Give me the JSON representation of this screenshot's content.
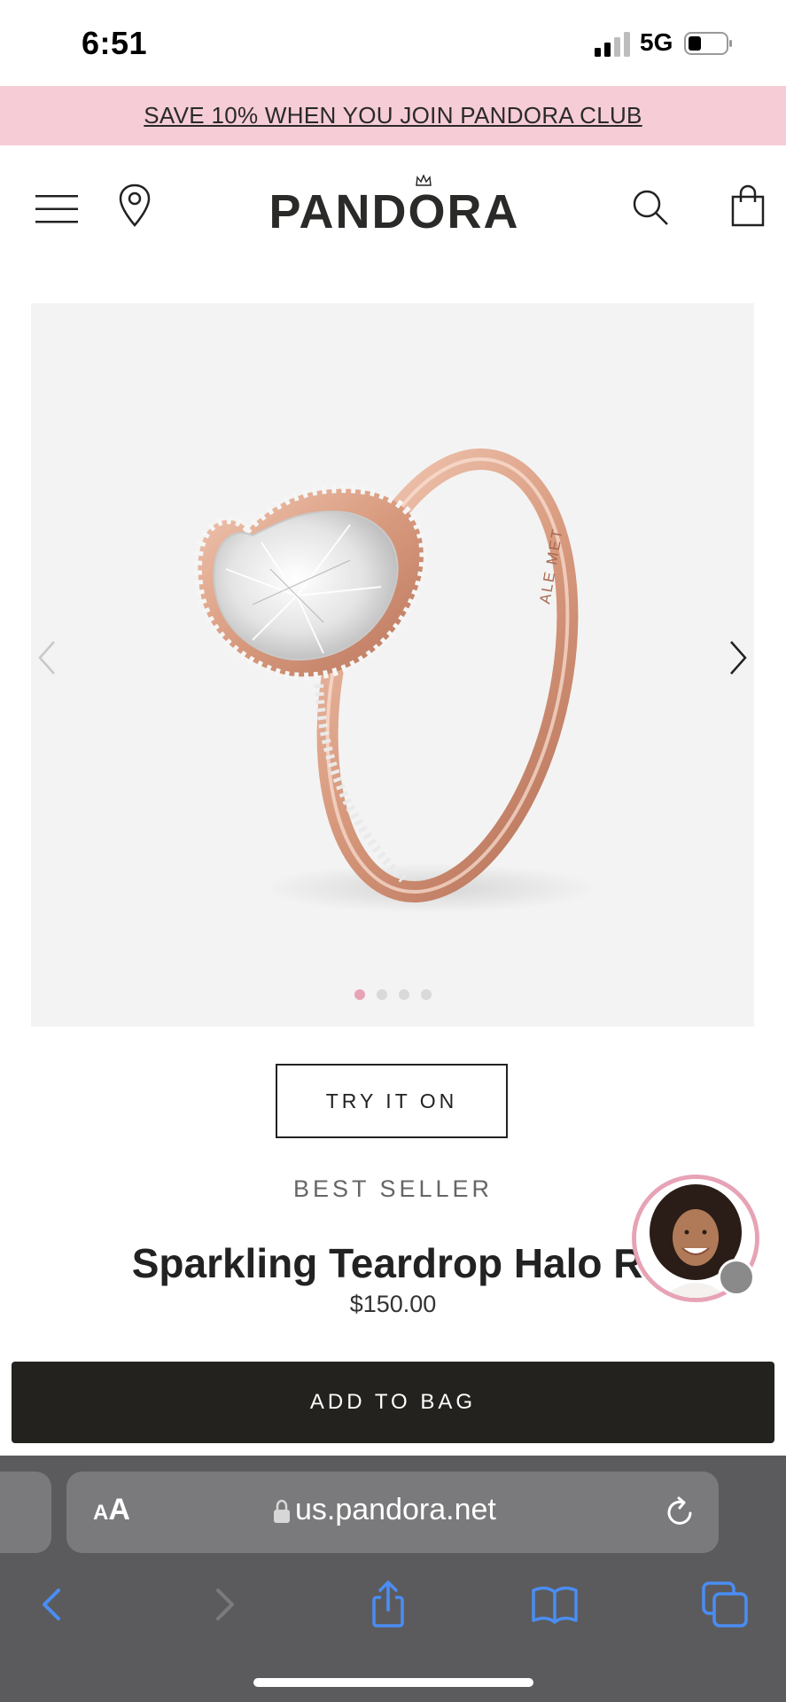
{
  "status_bar": {
    "time": "6:51",
    "network": "5G"
  },
  "promo": {
    "text": "SAVE 10% WHEN YOU JOIN PANDORA CLUB"
  },
  "header": {
    "brand": "PANDORA"
  },
  "carousel": {
    "image_count": 4,
    "active_index": 0,
    "active_dot_color": "#e7a3b5",
    "ring_engraving": "ALE MET"
  },
  "product": {
    "try_on_label": "TRY IT ON",
    "badge": "BEST SELLER",
    "title": "Sparkling Teardrop Halo Ri",
    "price": "$150.00",
    "add_to_bag_label": "ADD TO BAG"
  },
  "browser": {
    "aa_small": "A",
    "aa_large": "A",
    "url": "us.pandora.net",
    "accent_color": "#4a8df5"
  },
  "colors": {
    "promo_bg": "#f6ccd6",
    "button_dark": "#23221f",
    "browser_bg": "#5b5b5d"
  }
}
